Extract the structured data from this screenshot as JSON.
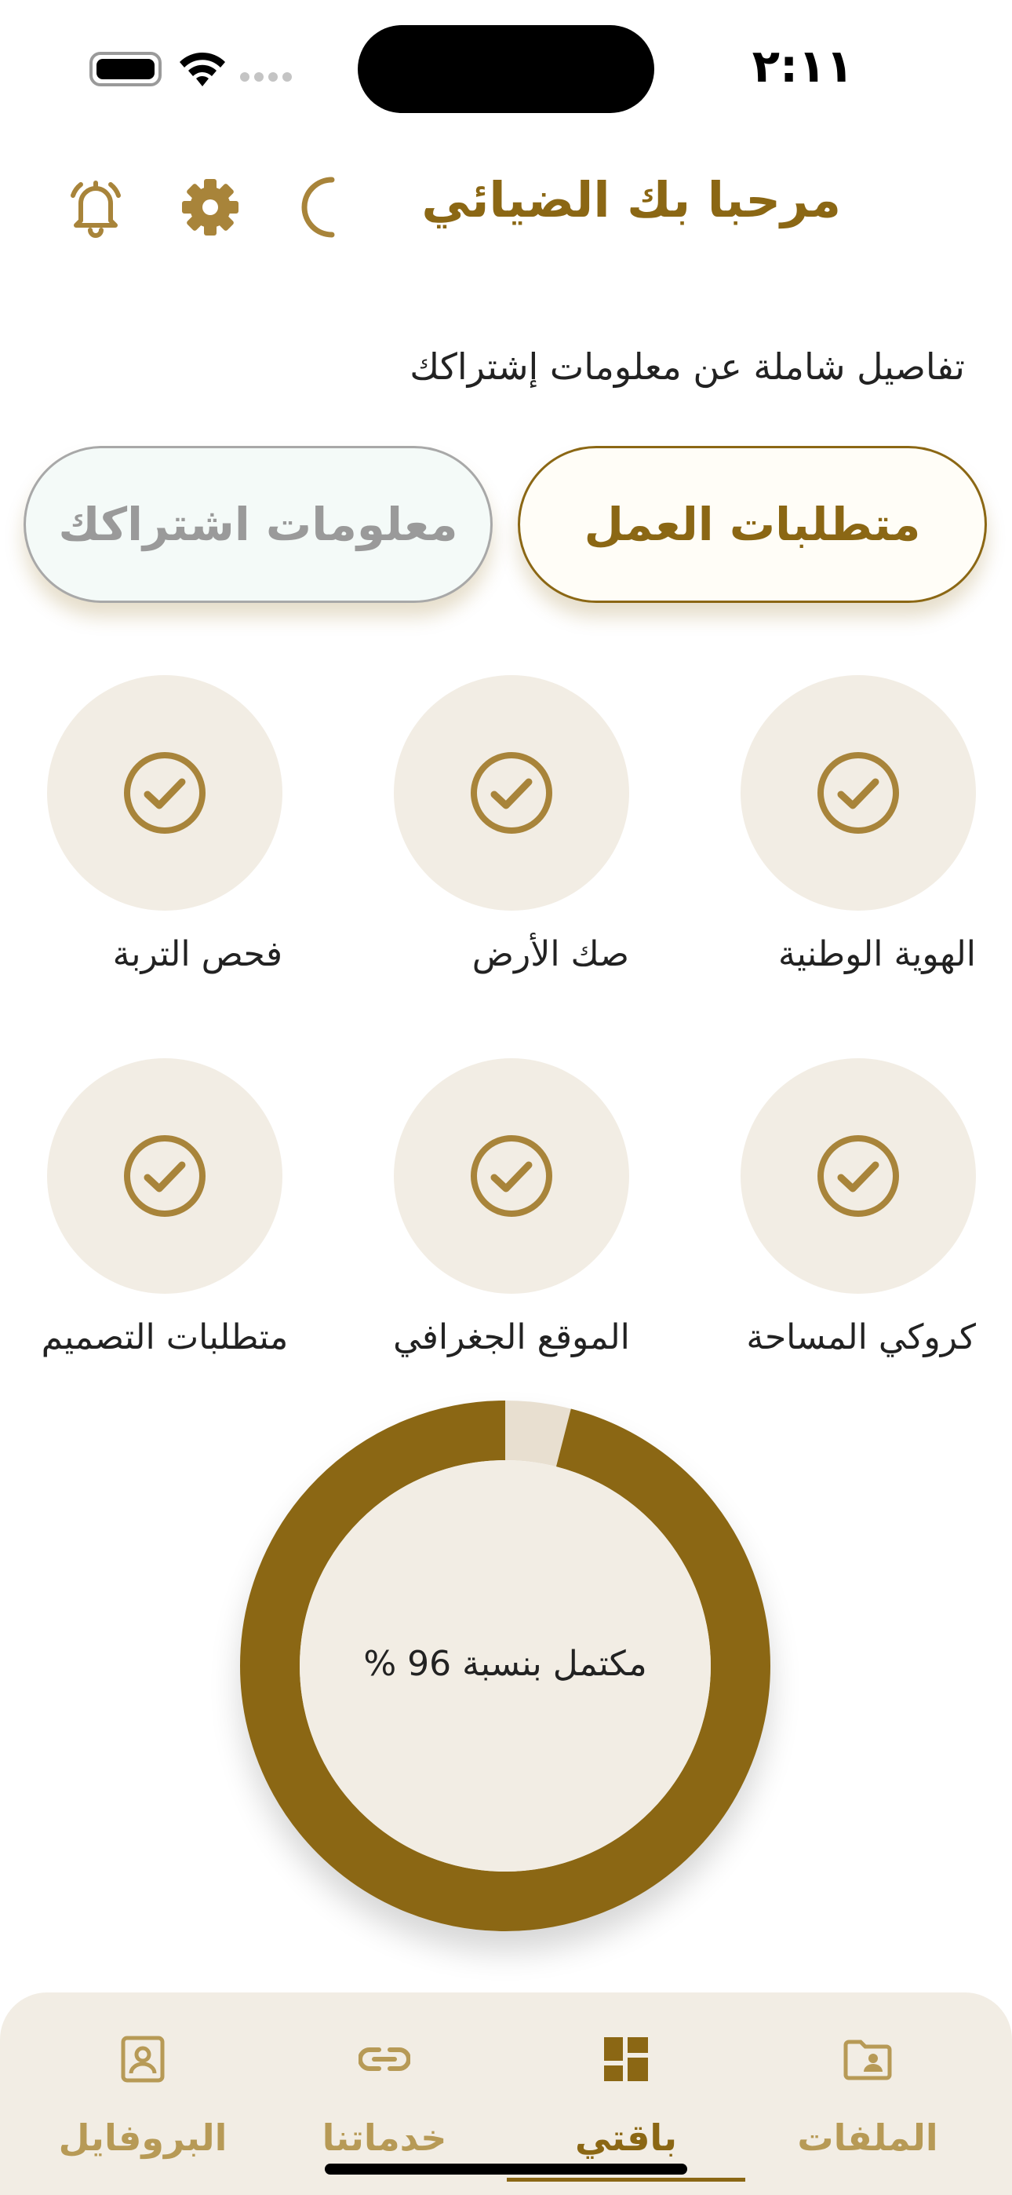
{
  "status_bar": {
    "time": "٢:١١"
  },
  "header": {
    "title": "مرحبا بك الضيائي",
    "icons": [
      "moon-icon",
      "gear-icon",
      "bell-icon"
    ]
  },
  "subtitle": "تفاصيل شاملة عن معلومات إشتراكك",
  "tabs": [
    {
      "label": "متطلبات العمل",
      "active": true
    },
    {
      "label": "معلومات اشتراكك",
      "active": false
    }
  ],
  "requirements": [
    {
      "label": "الهوية الوطنية",
      "done": true
    },
    {
      "label": "صك الأرض",
      "done": true
    },
    {
      "label": "فحص التربة",
      "done": true
    },
    {
      "label": "كروكي المساحة",
      "done": true
    },
    {
      "label": "الموقع الجغرافي",
      "done": true
    },
    {
      "label": "متطلبات التصميم",
      "done": true
    }
  ],
  "progress": {
    "percent": 96,
    "label": "مكتمل بنسبة 96 %",
    "colors": {
      "complete": "#8b6714",
      "remaining": "#e8dfd0",
      "center": "#f2ede4"
    }
  },
  "bottom_nav": [
    {
      "label": "الملفات",
      "icon": "folder-user-icon",
      "active": false
    },
    {
      "label": "باقتي",
      "icon": "dashboard-icon",
      "active": true
    },
    {
      "label": "خدماتنا",
      "icon": "link-icon",
      "active": false
    },
    {
      "label": "البروفايل",
      "icon": "profile-icon",
      "active": false
    }
  ],
  "colors": {
    "accent": "#8b6714",
    "accent_light": "#b79a56",
    "circle_bg": "#f2ede4"
  }
}
